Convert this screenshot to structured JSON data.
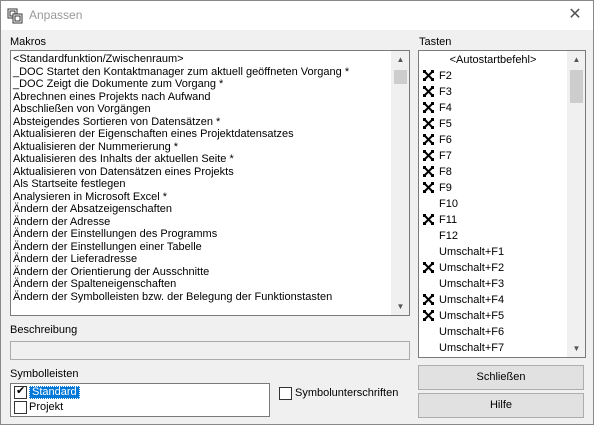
{
  "window": {
    "title": "Anpassen",
    "close_glyph": "✕"
  },
  "makros": {
    "label": "Makros",
    "items": [
      "<Standardfunktion/Zwischenraum>",
      "_DOC Startet den Kontaktmanager zum aktuell geöffneten Vorgang *",
      "_DOC Zeigt die Dokumente zum Vorgang *",
      "Abrechnen eines Projekts nach Aufwand",
      "Abschließen von Vorgängen",
      "Absteigendes Sortieren von Datensätzen *",
      "Aktualisieren der Eigenschaften eines Projektdatensatzes",
      "Aktualisieren der Nummerierung *",
      "Aktualisieren des Inhalts der aktuellen Seite *",
      "Aktualisieren von Datensätzen eines Projekts",
      "Als Startseite festlegen",
      "Analysieren in Microsoft Excel *",
      "Ändern der Absatzeigenschaften",
      "Ändern der Adresse",
      "Ändern der Einstellungen des Programms",
      "Ändern der Einstellungen einer Tabelle",
      "Ändern der Lieferadresse",
      "Ändern der Orientierung der Ausschnitte",
      "Ändern der Spalteneigenschaften",
      "Ändern der Symbolleisten bzw. der Belegung der Funktionstasten"
    ]
  },
  "tasten": {
    "label": "Tasten",
    "items": [
      {
        "label": "<Autostartbefehl>",
        "assigned": false,
        "centered": true
      },
      {
        "label": "F2",
        "assigned": true
      },
      {
        "label": "F3",
        "assigned": true
      },
      {
        "label": "F4",
        "assigned": true
      },
      {
        "label": "F5",
        "assigned": true
      },
      {
        "label": "F6",
        "assigned": true
      },
      {
        "label": "F7",
        "assigned": true
      },
      {
        "label": "F8",
        "assigned": true
      },
      {
        "label": "F9",
        "assigned": true
      },
      {
        "label": "F10",
        "assigned": false
      },
      {
        "label": "F11",
        "assigned": true
      },
      {
        "label": "F12",
        "assigned": false
      },
      {
        "label": "Umschalt+F1",
        "assigned": false
      },
      {
        "label": "Umschalt+F2",
        "assigned": true
      },
      {
        "label": "Umschalt+F3",
        "assigned": false
      },
      {
        "label": "Umschalt+F4",
        "assigned": true
      },
      {
        "label": "Umschalt+F5",
        "assigned": true
      },
      {
        "label": "Umschalt+F6",
        "assigned": false
      },
      {
        "label": "Umschalt+F7",
        "assigned": false
      }
    ]
  },
  "beschreibung": {
    "label": "Beschreibung",
    "value": ""
  },
  "symbolleisten": {
    "label": "Symbolleisten",
    "items": [
      {
        "label": "Standard",
        "checked": true,
        "selected": true
      },
      {
        "label": "Projekt",
        "checked": false,
        "selected": false
      }
    ]
  },
  "symbolunterschriften": {
    "label": "Symbolunterschriften",
    "checked": false
  },
  "buttons": {
    "close": "Schließen",
    "help": "Hilfe"
  },
  "colors": {
    "selection": "#0078d7"
  },
  "icons": {
    "assigned_key": "macro-key-icon"
  }
}
